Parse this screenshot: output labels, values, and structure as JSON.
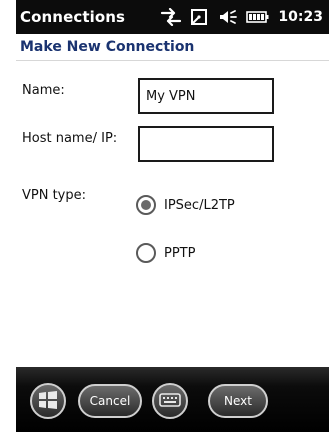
{
  "statusbar": {
    "title": "Connections",
    "time": "10:23",
    "icons": [
      "data-transfer-icon",
      "connection-icon",
      "volume-icon",
      "battery-icon"
    ]
  },
  "header": {
    "title": "Make New Connection"
  },
  "form": {
    "name_label": "Name:",
    "name_value": "My VPN",
    "host_label": "Host name/ IP:",
    "host_value": "",
    "vpn_label": "VPN type:",
    "vpn_options": [
      {
        "label": "IPSec/L2TP",
        "selected": true
      },
      {
        "label": "PPTP",
        "selected": false
      }
    ]
  },
  "softkeys": {
    "windows_icon": "windows-start-icon",
    "cancel_label": "Cancel",
    "keyboard_icon": "keyboard-icon",
    "next_label": "Next"
  },
  "colors": {
    "header_text": "#1a3370",
    "statusbar_bg": "#0c0c0c",
    "softkey_bar": "#000000"
  }
}
